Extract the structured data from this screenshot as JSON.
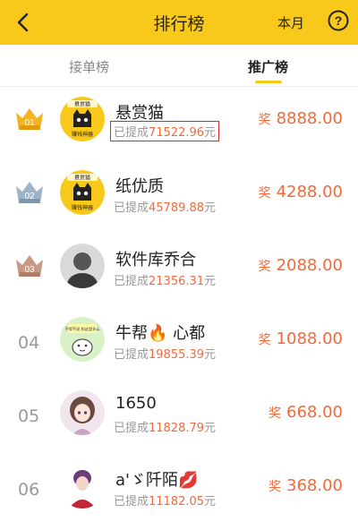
{
  "header": {
    "title": "排行榜",
    "period": "本月"
  },
  "tabs": [
    {
      "label": "接单榜",
      "active": false
    },
    {
      "label": "推广榜",
      "active": true
    }
  ],
  "withdrawn_prefix": "已提成",
  "currency_unit": "元",
  "reward_label": "奖",
  "avatar_badge_texts": {
    "cat_top": "悬赏猫",
    "cat_bottom": "赚钱神器",
    "cartoon": "不得不说 和这是多么"
  },
  "rows": [
    {
      "rank": "01",
      "name": "悬赏猫",
      "withdrawn": "71522.96",
      "reward": "8888.00",
      "highlighted": true,
      "crown": "gold"
    },
    {
      "rank": "02",
      "name": "纸优质",
      "withdrawn": "45789.88",
      "reward": "4288.00",
      "highlighted": false,
      "crown": "silver"
    },
    {
      "rank": "03",
      "name": "软件库乔合",
      "withdrawn": "21356.31",
      "reward": "2088.00",
      "highlighted": false,
      "crown": "bronze"
    },
    {
      "rank": "04",
      "name": "牛帮🔥 心都",
      "withdrawn": "19855.39",
      "reward": "1088.00",
      "highlighted": false,
      "crown": ""
    },
    {
      "rank": "05",
      "name": "1650",
      "withdrawn": "11828.79",
      "reward": "668.00",
      "highlighted": false,
      "crown": ""
    },
    {
      "rank": "06",
      "name": "a'ゞ阡陌💋",
      "withdrawn": "11182.05",
      "reward": "368.00",
      "highlighted": false,
      "crown": ""
    }
  ],
  "colors": {
    "header_bg": "#f8c91a",
    "accent_orange": "#f06a3b",
    "highlight_border": "#d9262b",
    "gold_crown": "#f5b324",
    "silver_crown": "#9fb3c8",
    "bronze_crown": "#c99a83"
  },
  "icons": {
    "back": "chevron-left-icon",
    "help": "question-circle-icon"
  }
}
